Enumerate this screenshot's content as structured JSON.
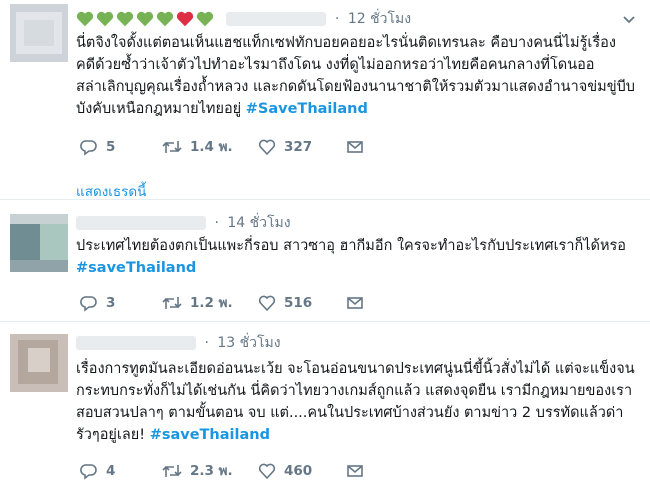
{
  "tweets": [
    {
      "time": "12 ชั่วโมง",
      "lines": [
        "นี่ตจิงใจดั้งแต่ตอนเห็นแฮชแท็กเซฟทักบอยคอยอะไรนั่นติดเทรนละ คือบางคนนี่ไม่รู้เรื่อง",
        "คดีด้วยซ้ำว่าเจ้าตัวไปทำอะไรมาถึงโดน งงที่ดูไม่ออกหรอว่าไทยคือคนกลางที่โดนออ",
        "สล่าเลิกบุญคุณเรื่องถ้ำหลวง และกดดันโดยฟ้องนานาชาติให้รวมตัวมาแสดงอำนาจข่มขู่บีบ",
        "บังคับเหนือกฎหมายไทยอยู่"
      ],
      "hashtag": "#SaveThailand",
      "replies": "5",
      "retweets": "1.4 พ.",
      "likes": "327",
      "thread_link": "แสดงเธรดนี้"
    },
    {
      "time": "14 ชั่วโมง",
      "lines": [
        "ประเทศไทยต้องตกเป็นแพะกี่รอบ สาวซาอุ ฮากีมอีก ใครจะทำอะไรกับประเทศเราก็ได้หรอ"
      ],
      "hashtag": "#saveThailand",
      "replies": "3",
      "retweets": "1.2 พ.",
      "likes": "516"
    },
    {
      "time": "13 ชั่วโมง",
      "lines": [
        "เรื่องการทูตมันละเอียดอ่อนนะเว้ย จะโอนอ่อนขนาดประเทศนู่นนี่ขี้นิ้วสั่งไม่ได้ แต่จะแข็งจน",
        "กระทบกระทั่งก็ไม่ได้เช่นกัน นี่คิดว่าไทยวางเกมส์ถูกแล้ว แสดงจุดยืน เรามีกฎหมายของเรา",
        "สอบสวนปลาๆ ตามขั้นตอน จบ แต่....คนในประเทศบ้างส่วนยัง ตามข่าว 2 บรรทัดแล้วด่า",
        "รัวๆอยู่เลย!"
      ],
      "hashtag": "#saveThailand",
      "replies": "4",
      "retweets": "2.3 พ.",
      "likes": "460"
    }
  ],
  "icons": {
    "reply": "reply-icon",
    "retweet": "retweet-icon",
    "like": "heart-icon",
    "message": "direct-message-icon",
    "more": "chevron-down-icon"
  },
  "colors": {
    "hashtag": "#1b95e0",
    "meta": "#657786",
    "heart_green": "#77b255",
    "heart_red": "#dd2e44"
  }
}
